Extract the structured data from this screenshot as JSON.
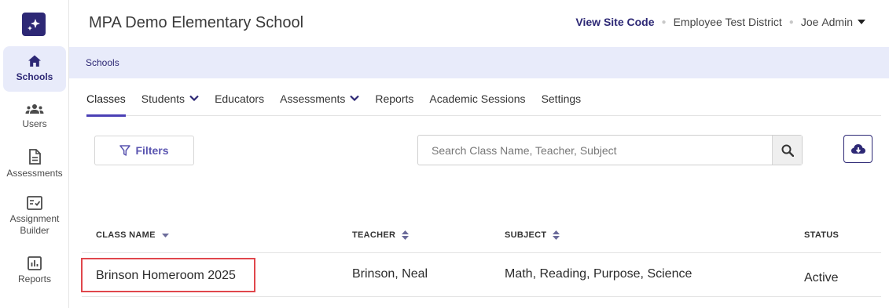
{
  "sidebar": {
    "items": [
      {
        "label": "Schools",
        "icon": "home-icon",
        "active": true
      },
      {
        "label": "Users",
        "icon": "users-icon",
        "active": false
      },
      {
        "label": "Assessments",
        "icon": "document-icon",
        "active": false
      },
      {
        "label": "Assignment Builder",
        "icon": "checklist-icon",
        "active": false
      },
      {
        "label": "Reports",
        "icon": "bar-chart-icon",
        "active": false
      }
    ]
  },
  "header": {
    "title": "MPA Demo Elementary School",
    "site_code_label": "View Site Code",
    "district": "Employee Test District",
    "user_first": "Joe",
    "user_last": "Admin"
  },
  "breadcrumb": {
    "label": "Schools"
  },
  "tabs": [
    {
      "label": "Classes",
      "active": true,
      "dropdown": false
    },
    {
      "label": "Students",
      "active": false,
      "dropdown": true
    },
    {
      "label": "Educators",
      "active": false,
      "dropdown": false
    },
    {
      "label": "Assessments",
      "active": false,
      "dropdown": true
    },
    {
      "label": "Reports",
      "active": false,
      "dropdown": false
    },
    {
      "label": "Academic Sessions",
      "active": false,
      "dropdown": false
    },
    {
      "label": "Settings",
      "active": false,
      "dropdown": false
    }
  ],
  "toolbar": {
    "filters_label": "Filters",
    "search_placeholder": "Search Class Name, Teacher, Subject"
  },
  "table": {
    "headers": [
      "CLASS NAME",
      "TEACHER",
      "SUBJECT",
      "STATUS"
    ],
    "rows": [
      {
        "class_name": "Brinson Homeroom 2025",
        "teacher": "Brinson, Neal",
        "subject": "Math, Reading, Purpose, Science",
        "status": "Active"
      }
    ]
  },
  "colors": {
    "brand": "#2d2875",
    "accent": "#4a3fb5",
    "breadcrumb_bg": "#e8ebfa",
    "highlight_border": "#e0474c"
  }
}
